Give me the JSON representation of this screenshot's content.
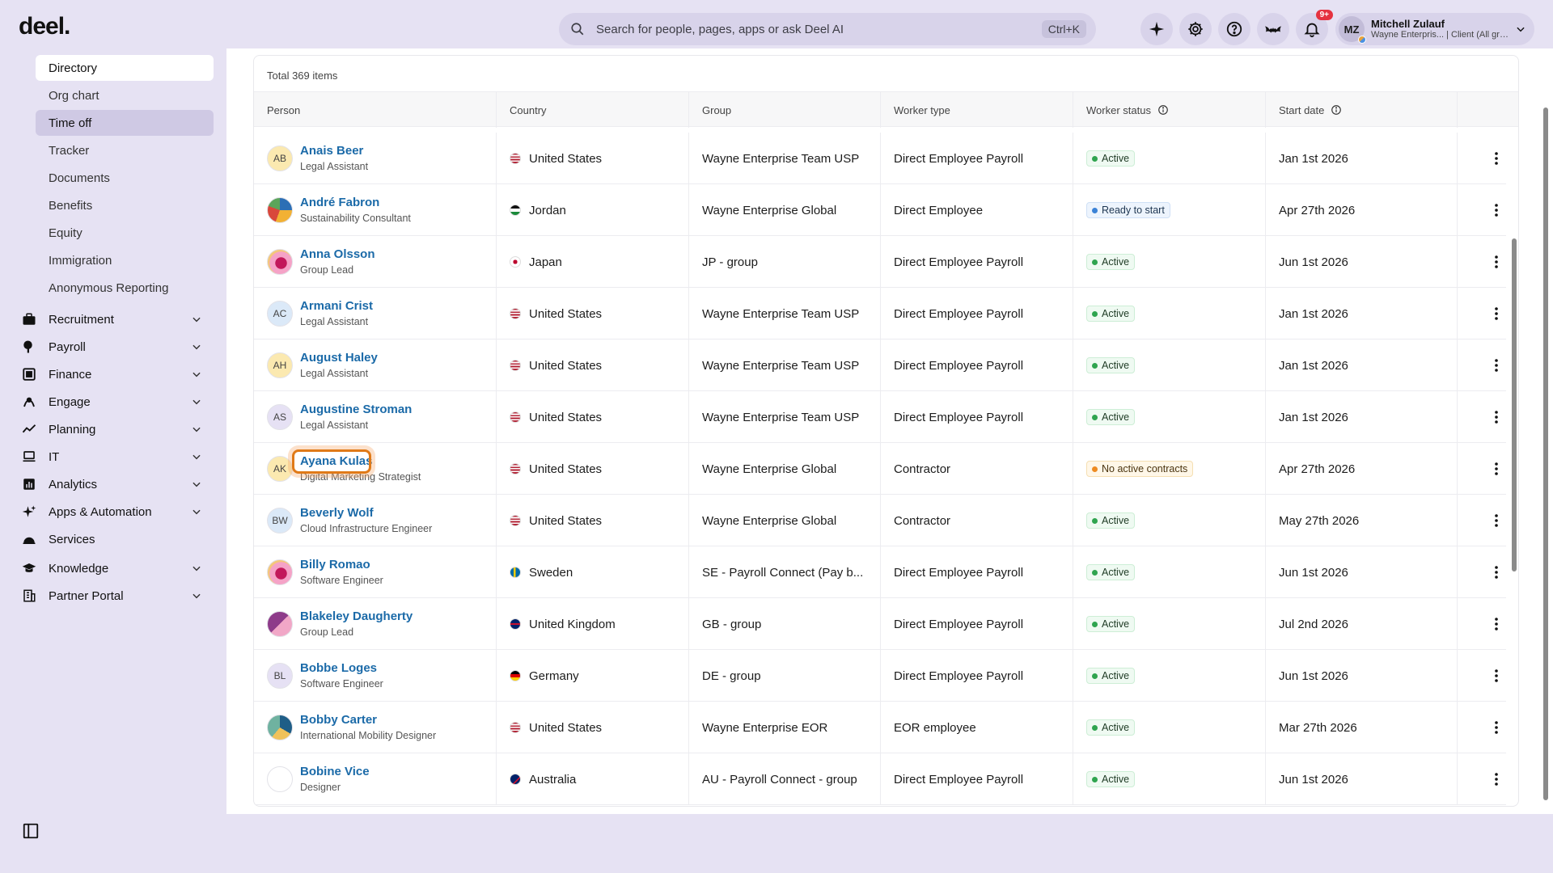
{
  "brand": {
    "logo": "deel."
  },
  "search": {
    "placeholder": "Search for people, pages, apps or ask Deel AI",
    "shortcut": "Ctrl+K"
  },
  "notifications": {
    "badge": "9+"
  },
  "user": {
    "initials": "MZ",
    "name": "Mitchell Zulauf",
    "subtitle": "Wayne Enterpris... | Client (All gro..."
  },
  "sidebar": {
    "sub_items": [
      "Directory",
      "Org chart",
      "Time off",
      "Tracker",
      "Documents",
      "Benefits",
      "Equity",
      "Immigration",
      "Anonymous Reporting"
    ],
    "sections": [
      {
        "label": "Recruitment",
        "icon": "briefcase-icon",
        "expandable": true
      },
      {
        "label": "Payroll",
        "icon": "payroll-icon",
        "expandable": true
      },
      {
        "label": "Finance",
        "icon": "finance-icon",
        "expandable": true
      },
      {
        "label": "Engage",
        "icon": "engage-icon",
        "expandable": true
      },
      {
        "label": "Planning",
        "icon": "planning-icon",
        "expandable": true
      },
      {
        "label": "IT",
        "icon": "laptop-icon",
        "expandable": true
      },
      {
        "label": "Analytics",
        "icon": "analytics-icon",
        "expandable": true
      },
      {
        "label": "Apps & Automation",
        "icon": "sparkle-icon",
        "expandable": true
      },
      {
        "label": "Services",
        "icon": "services-icon",
        "expandable": false
      },
      {
        "label": "Knowledge",
        "icon": "graduation-icon",
        "expandable": true
      },
      {
        "label": "Partner Portal",
        "icon": "building-icon",
        "expandable": true
      }
    ]
  },
  "table": {
    "total": "Total 369 items",
    "columns": [
      "Person",
      "Country",
      "Group",
      "Worker type",
      "Worker status",
      "Start date"
    ],
    "rows": [
      {
        "initials": "AB",
        "name": "Anais Beer",
        "role": "Legal Assistant",
        "country": "United States",
        "flag": "us",
        "group": "Wayne Enterprise Team USP",
        "type": "Direct Employee Payroll",
        "status": "Active",
        "status_kind": "active",
        "start": "Jan 1st 2026",
        "avatar": "#fbe9b0"
      },
      {
        "initials": "",
        "name": "André Fabron",
        "role": "Sustainability Consultant",
        "country": "Jordan",
        "flag": "jo",
        "group": "Wayne Enterprise Global",
        "type": "Direct Employee",
        "status": "Ready to start",
        "status_kind": "ready",
        "start": "Apr 27th 2026",
        "avatar": "photo-a"
      },
      {
        "initials": "",
        "name": "Anna Olsson",
        "role": "Group Lead",
        "country": "Japan",
        "flag": "jp",
        "group": "JP - group",
        "type": "Direct Employee Payroll",
        "status": "Active",
        "status_kind": "active",
        "start": "Jun 1st 2026",
        "avatar": "photo-b"
      },
      {
        "initials": "AC",
        "name": "Armani Crist",
        "role": "Legal Assistant",
        "country": "United States",
        "flag": "us",
        "group": "Wayne Enterprise Team USP",
        "type": "Direct Employee Payroll",
        "status": "Active",
        "status_kind": "active",
        "start": "Jan 1st 2026",
        "avatar": "#dbe9f8"
      },
      {
        "initials": "AH",
        "name": "August Haley",
        "role": "Legal Assistant",
        "country": "United States",
        "flag": "us",
        "group": "Wayne Enterprise Team USP",
        "type": "Direct Employee Payroll",
        "status": "Active",
        "status_kind": "active",
        "start": "Jan 1st 2026",
        "avatar": "#fbe9b0"
      },
      {
        "initials": "AS",
        "name": "Augustine Stroman",
        "role": "Legal Assistant",
        "country": "United States",
        "flag": "us",
        "group": "Wayne Enterprise Team USP",
        "type": "Direct Employee Payroll",
        "status": "Active",
        "status_kind": "active",
        "start": "Jan 1st 2026",
        "avatar": "#e6e1f4"
      },
      {
        "initials": "AK",
        "name": "Ayana Kulas",
        "role": "Digital Marketing Strategist",
        "country": "United States",
        "flag": "us",
        "group": "Wayne Enterprise Global",
        "type": "Contractor",
        "status": "No active contracts",
        "status_kind": "none",
        "start": "Apr 27th 2026",
        "avatar": "#fbe9b0"
      },
      {
        "initials": "BW",
        "name": "Beverly Wolf",
        "role": "Cloud Infrastructure Engineer",
        "country": "United States",
        "flag": "us",
        "group": "Wayne Enterprise Global",
        "type": "Contractor",
        "status": "Active",
        "status_kind": "active",
        "start": "May 27th 2026",
        "avatar": "#dbe9f8"
      },
      {
        "initials": "",
        "name": "Billy Romao",
        "role": "Software Engineer",
        "country": "Sweden",
        "flag": "se",
        "group": "SE - Payroll Connect (Pay b...",
        "type": "Direct Employee Payroll",
        "status": "Active",
        "status_kind": "active",
        "start": "Jun 1st 2026",
        "avatar": "photo-b"
      },
      {
        "initials": "",
        "name": "Blakeley Daugherty",
        "role": "Group Lead",
        "country": "United Kingdom",
        "flag": "gb",
        "group": "GB - group",
        "type": "Direct Employee Payroll",
        "status": "Active",
        "status_kind": "active",
        "start": "Jul 2nd 2026",
        "avatar": "photo-c"
      },
      {
        "initials": "BL",
        "name": "Bobbe Loges",
        "role": "Software Engineer",
        "country": "Germany",
        "flag": "de",
        "group": "DE - group",
        "type": "Direct Employee Payroll",
        "status": "Active",
        "status_kind": "active",
        "start": "Jun 1st 2026",
        "avatar": "#e6e1f4"
      },
      {
        "initials": "",
        "name": "Bobby Carter",
        "role": "International Mobility Designer",
        "country": "United States",
        "flag": "us",
        "group": "Wayne Enterprise EOR",
        "type": "EOR employee",
        "status": "Active",
        "status_kind": "active",
        "start": "Mar 27th 2026",
        "avatar": "photo-d"
      },
      {
        "initials": "",
        "name": "Bobine Vice",
        "role": "Designer",
        "country": "Australia",
        "flag": "au",
        "group": "AU - Payroll Connect - group",
        "type": "Direct Employee Payroll",
        "status": "Active",
        "status_kind": "active",
        "start": "Jun 1st 2026",
        "avatar": "#ffffff"
      }
    ]
  }
}
